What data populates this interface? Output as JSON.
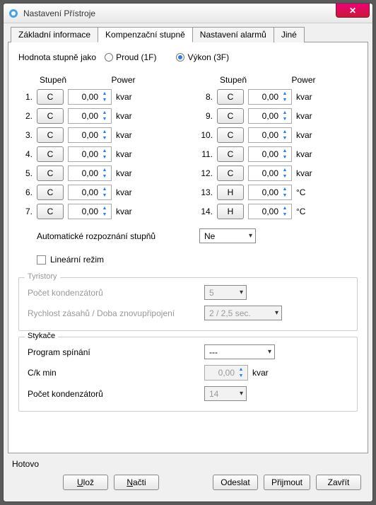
{
  "title": "Nastavení Přístroje",
  "tabs": [
    "Základní informace",
    "Kompenzační stupně",
    "Nastavení alarmů",
    "Jiné"
  ],
  "activeTab": 1,
  "valueAs": {
    "label": "Hodnota stupně jako",
    "opt1": "Proud (1F)",
    "opt2": "Výkon (3F)",
    "selected": 2
  },
  "head": {
    "stage": "Stupeň",
    "power": "Power"
  },
  "left": [
    {
      "n": "1.",
      "s": "C",
      "v": "0,00",
      "u": "kvar"
    },
    {
      "n": "2.",
      "s": "C",
      "v": "0,00",
      "u": "kvar"
    },
    {
      "n": "3.",
      "s": "C",
      "v": "0,00",
      "u": "kvar"
    },
    {
      "n": "4.",
      "s": "C",
      "v": "0,00",
      "u": "kvar"
    },
    {
      "n": "5.",
      "s": "C",
      "v": "0,00",
      "u": "kvar"
    },
    {
      "n": "6.",
      "s": "C",
      "v": "0,00",
      "u": "kvar"
    },
    {
      "n": "7.",
      "s": "C",
      "v": "0,00",
      "u": "kvar"
    }
  ],
  "right": [
    {
      "n": "8.",
      "s": "C",
      "v": "0,00",
      "u": "kvar"
    },
    {
      "n": "9.",
      "s": "C",
      "v": "0,00",
      "u": "kvar"
    },
    {
      "n": "10.",
      "s": "C",
      "v": "0,00",
      "u": "kvar"
    },
    {
      "n": "11.",
      "s": "C",
      "v": "0,00",
      "u": "kvar"
    },
    {
      "n": "12.",
      "s": "C",
      "v": "0,00",
      "u": "kvar"
    },
    {
      "n": "13.",
      "s": "H",
      "v": "0,00",
      "u": "°C"
    },
    {
      "n": "14.",
      "s": "H",
      "v": "0,00",
      "u": "°C"
    }
  ],
  "autoDetect": {
    "label": "Automatické rozpoznání stupňů",
    "value": "Ne"
  },
  "linear": {
    "label": "Lineární režim"
  },
  "thyristors": {
    "title": "Tyristory",
    "count": {
      "label": "Počet kondenzátorů",
      "value": "5"
    },
    "speed": {
      "label": "Rychlost zásahů / Doba znovupřipojení",
      "value": "2 / 2,5 sec."
    }
  },
  "contactors": {
    "title": "Stykače",
    "program": {
      "label": "Program spínání",
      "value": "---"
    },
    "ck": {
      "label": "C/k min",
      "value": "0,00",
      "unit": "kvar"
    },
    "count": {
      "label": "Počet kondenzátorů",
      "value": "14"
    }
  },
  "status": "Hotovo",
  "buttons": {
    "save": "Ulož",
    "load": "Načti",
    "send": "Odeslat",
    "receive": "Přijmout",
    "close": "Zavřít"
  }
}
